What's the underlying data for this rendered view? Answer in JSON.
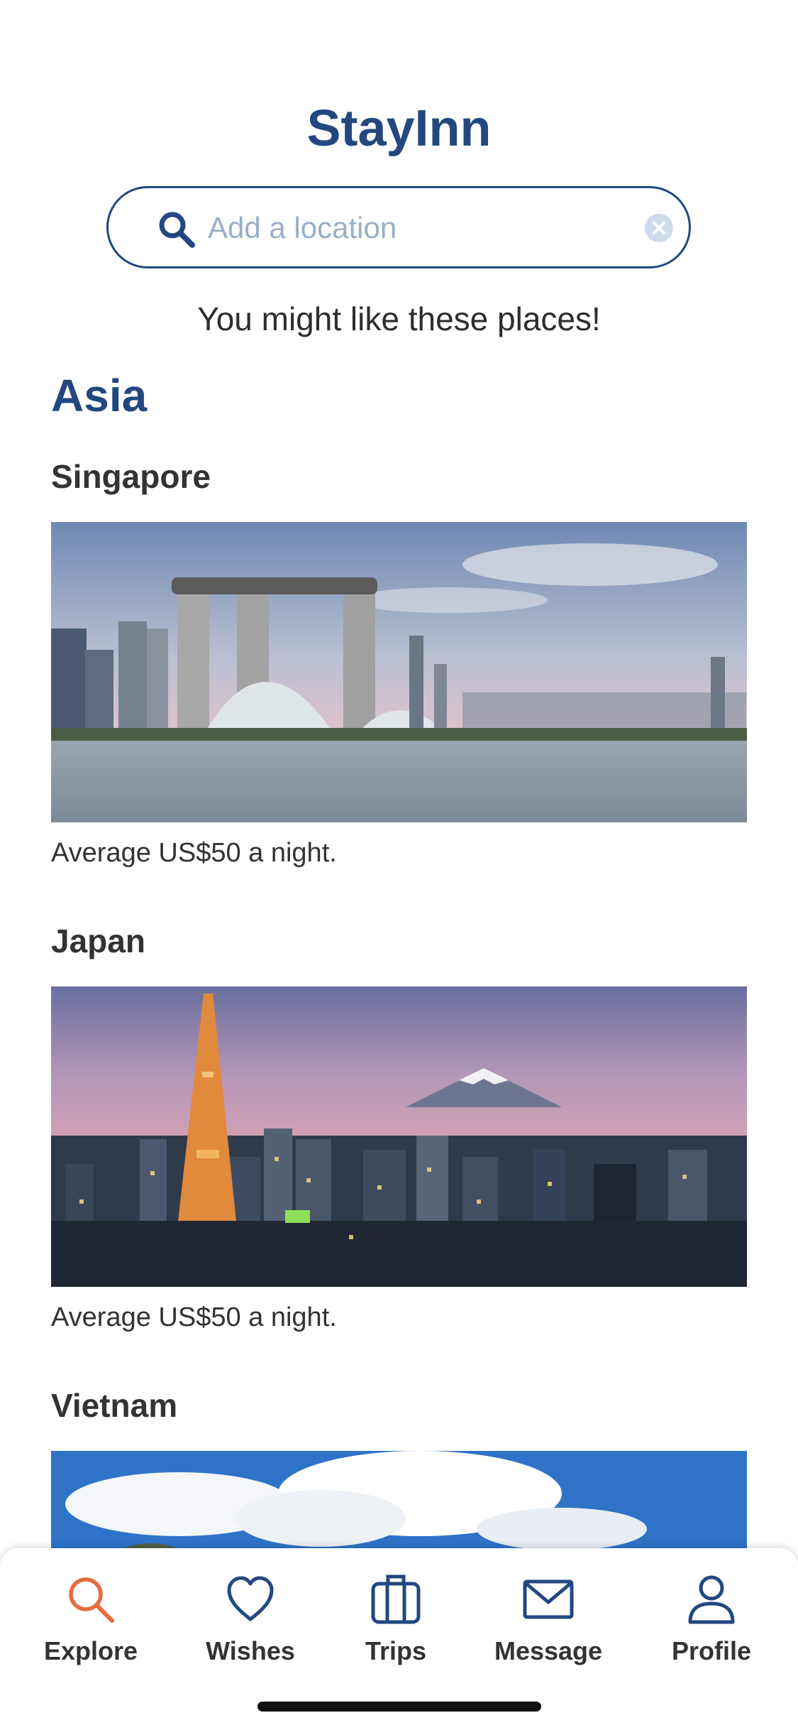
{
  "header": {
    "title": "StayInn"
  },
  "search": {
    "placeholder": "Add a location"
  },
  "tagline": "You might like these places!",
  "region": "Asia",
  "places": [
    {
      "name": "Singapore",
      "price": "Average US$50 a night."
    },
    {
      "name": "Japan",
      "price": "Average US$50 a night."
    },
    {
      "name": "Vietnam"
    }
  ],
  "tabs": [
    {
      "label": "Explore",
      "icon": "search-icon",
      "active": true
    },
    {
      "label": "Wishes",
      "icon": "heart-icon"
    },
    {
      "label": "Trips",
      "icon": "suitcase-icon"
    },
    {
      "label": "Message",
      "icon": "envelope-icon"
    },
    {
      "label": "Profile",
      "icon": "person-icon"
    }
  ],
  "colors": {
    "brand": "#23487f",
    "active_tab": "#e86a3e",
    "text": "#333333"
  }
}
